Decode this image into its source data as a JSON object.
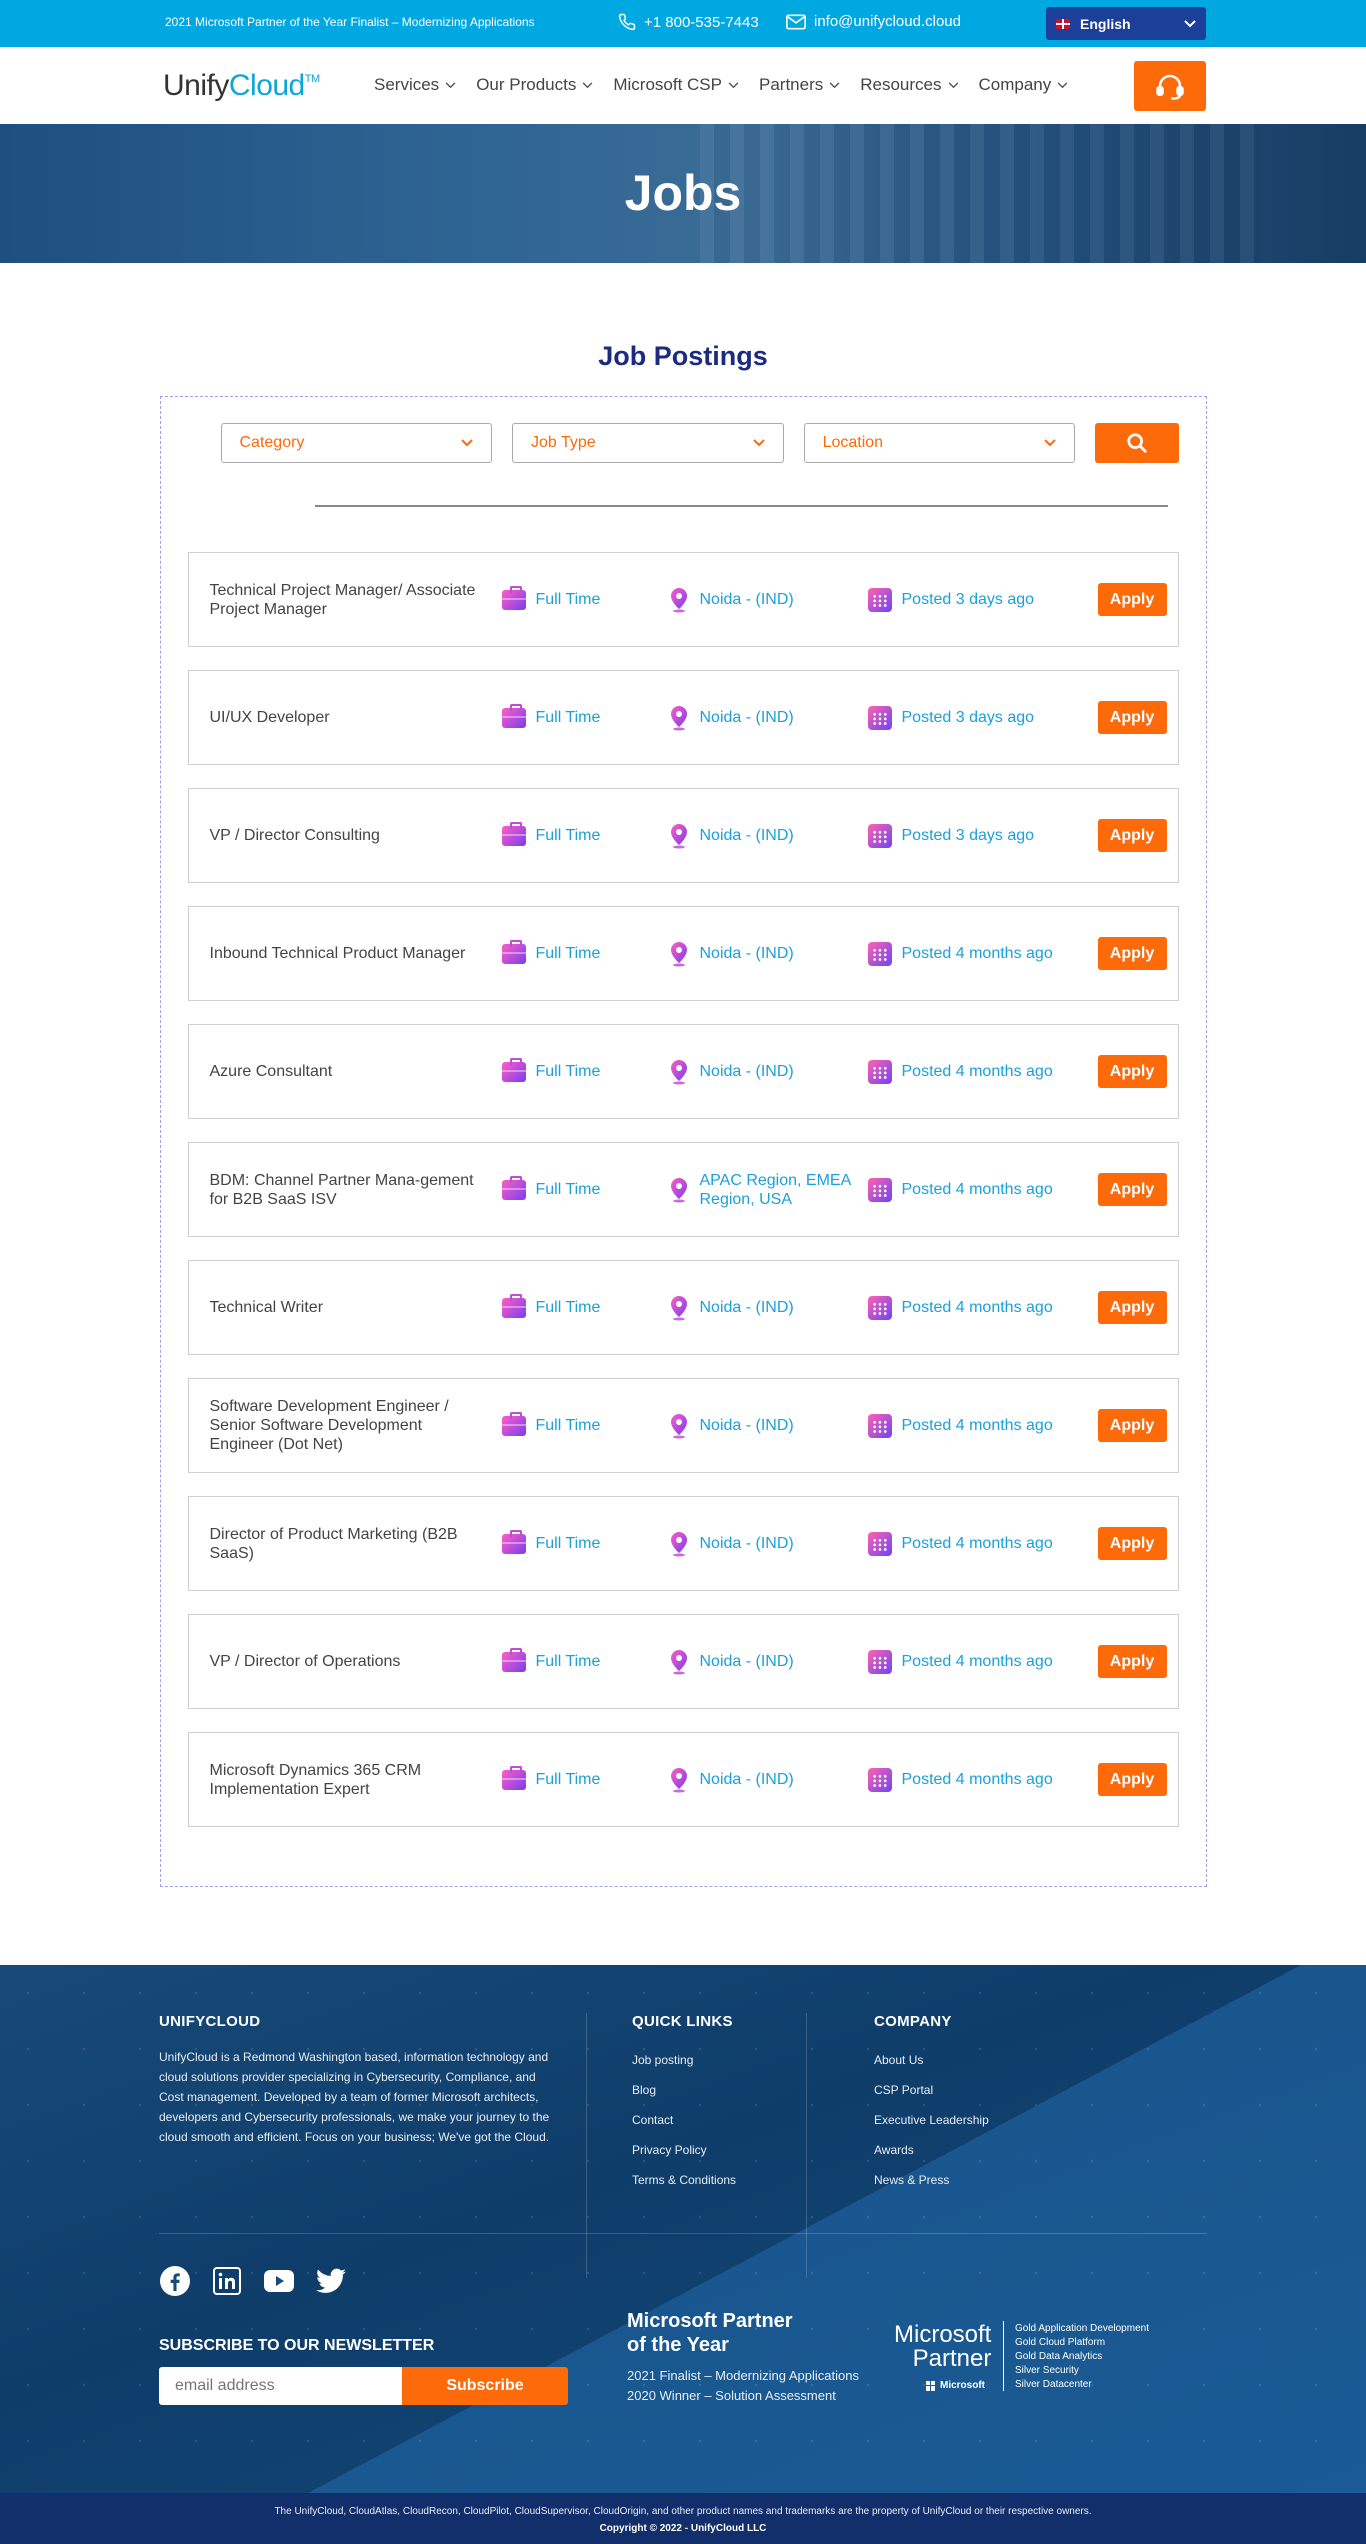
{
  "topbar": {
    "promo": "2021 Microsoft Partner of the Year Finalist – Modernizing Applications",
    "phone": "+1 800-535-7443",
    "email": "info@unifycloud.cloud",
    "language": "English",
    "icons": [
      "phone-icon",
      "mail-icon",
      "uk-flag-icon",
      "chevron-down-icon"
    ]
  },
  "nav": {
    "logo_part1": "Unify",
    "logo_part2": "Cloud",
    "logo_tm": "TM",
    "menu": [
      "Services",
      "Our Products",
      "Microsoft CSP",
      "Partners",
      "Resources",
      "Company"
    ],
    "support_icon": "headset-icon"
  },
  "hero": {
    "title": "Jobs"
  },
  "postings": {
    "title": "Job Postings",
    "filters": {
      "category": "Category",
      "job_type": "Job Type",
      "location": "Location"
    },
    "search_icon": "search-icon",
    "apply_label": "Apply",
    "jobs": [
      {
        "title": "Technical Project Manager/ Associate Project Manager",
        "type": "Full Time",
        "location": "Noida - (IND)",
        "posted": "Posted 3 days ago"
      },
      {
        "title": "UI/UX Developer",
        "type": "Full Time",
        "location": "Noida - (IND)",
        "posted": "Posted 3 days ago"
      },
      {
        "title": "VP / Director Consulting",
        "type": "Full Time",
        "location": "Noida - (IND)",
        "posted": "Posted 3 days ago"
      },
      {
        "title": "Inbound Technical Product Manager",
        "type": "Full Time",
        "location": "Noida - (IND)",
        "posted": "Posted 4 months ago"
      },
      {
        "title": "Azure Consultant",
        "type": "Full Time",
        "location": "Noida - (IND)",
        "posted": "Posted 4 months ago"
      },
      {
        "title": "BDM: Channel Partner Mana-gement for B2B SaaS ISV",
        "type": "Full Time",
        "location": "APAC Region, EMEA Region, USA",
        "posted": "Posted 4 months ago"
      },
      {
        "title": "Technical Writer",
        "type": "Full Time",
        "location": "Noida - (IND)",
        "posted": "Posted 4 months ago"
      },
      {
        "title": "Software Development Engineer / Senior Software Development Engineer (Dot Net)",
        "type": "Full Time",
        "location": "Noida - (IND)",
        "posted": "Posted 4 months ago"
      },
      {
        "title": "Director of Product Marketing (B2B SaaS)",
        "type": "Full Time",
        "location": "Noida - (IND)",
        "posted": "Posted 4 months ago"
      },
      {
        "title": "VP / Director of Operations",
        "type": "Full Time",
        "location": "Noida - (IND)",
        "posted": "Posted 4 months ago"
      },
      {
        "title": "Microsoft Dynamics 365 CRM Implementation Expert",
        "type": "Full Time",
        "location": "Noida - (IND)",
        "posted": "Posted 4 months ago"
      }
    ]
  },
  "footer": {
    "about_title": "UNIFYCLOUD",
    "about_text": "UnifyCloud is a Redmond Washington based, information technology and cloud solutions provider specializing in Cybersecurity, Compliance, and Cost management. Developed by a team of former Microsoft architects, developers and Cybersecurity professionals, we make your journey to the cloud smooth and efficient. Focus on your business; We've got the Cloud.",
    "quick_links_title": "QUICK LINKS",
    "quick_links": [
      "Job posting",
      "Blog",
      "Contact",
      "Privacy Policy",
      "Terms & Conditions"
    ],
    "company_title": "COMPANY",
    "company_links": [
      "About Us",
      "CSP Portal",
      "Executive Leadership",
      "Awards",
      "News & Press"
    ],
    "social_icons": [
      "facebook-icon",
      "linkedin-icon",
      "youtube-icon",
      "twitter-icon"
    ],
    "newsletter_title": "SUBSCRIBE TO OUR NEWSLETTER",
    "email_placeholder": "email address",
    "subscribe_label": "Subscribe",
    "partner_title_1": "Microsoft Partner",
    "partner_title_2": "of the Year",
    "partner_lines": [
      "2021 Finalist – Modernizing Applications",
      "2020 Winner – Solution Assessment"
    ],
    "ms_logo_1": "Microsoft",
    "ms_logo_2": "Partner",
    "ms_mini": "Microsoft",
    "competencies": [
      "Gold Application Development",
      "Gold Cloud Platform",
      "Gold Data Analytics",
      "Silver Security",
      "Silver Datacenter"
    ],
    "legal": "The UnifyCloud, CloudAtlas, CloudRecon, CloudPilot, CloudSupervisor, CloudOrigin, and other product names and trademarks are the property of UnifyCloud or their respective owners.",
    "copyright": "Copyright © 2022 - UnifyCloud LLC"
  },
  "colors": {
    "accent": "#fc6a0a",
    "brand_blue": "#00a8e1",
    "navy": "#1c2a80",
    "link_blue": "#1ba0db"
  }
}
